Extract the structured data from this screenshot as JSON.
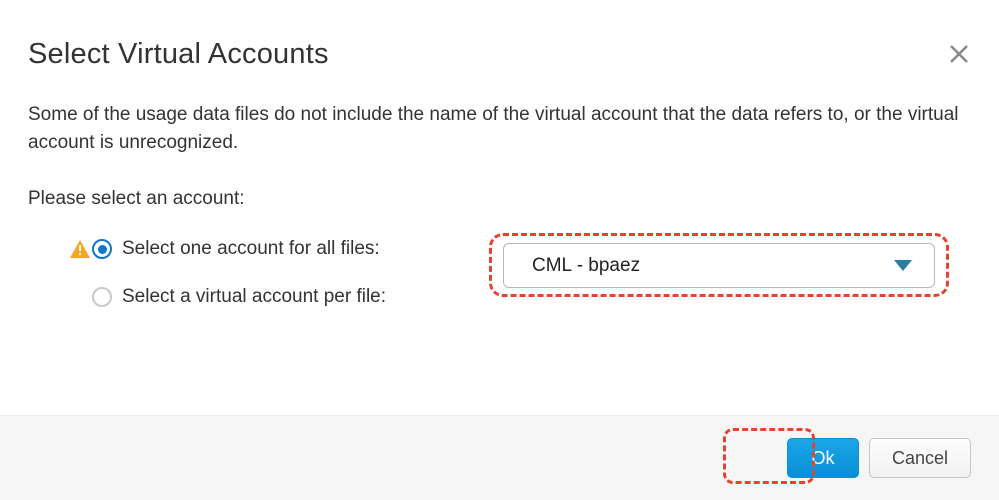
{
  "dialog": {
    "title": "Select Virtual Accounts",
    "description": "Some of the usage data files do not include the name of the virtual account that the data refers to, or the virtual account is unrecognized.",
    "prompt": "Please select an account:",
    "options": {
      "all_files": {
        "label": "Select one account for all files:",
        "selected": true,
        "warning": true
      },
      "per_file": {
        "label": "Select a virtual account per file:",
        "selected": false
      }
    },
    "account_select": {
      "value": "CML - bpaez"
    },
    "buttons": {
      "ok": "Ok",
      "cancel": "Cancel"
    }
  },
  "icons": {
    "close": "close-icon",
    "warning": "warning-icon",
    "radio_selected": "radio-selected-icon",
    "radio_unselected": "radio-unselected-icon",
    "dropdown_caret": "chevron-down-icon"
  },
  "colors": {
    "accent": "#0b78d1",
    "primary_button": "#0a8fd6",
    "highlight": "#e2452f",
    "warning": "#f5a623"
  }
}
